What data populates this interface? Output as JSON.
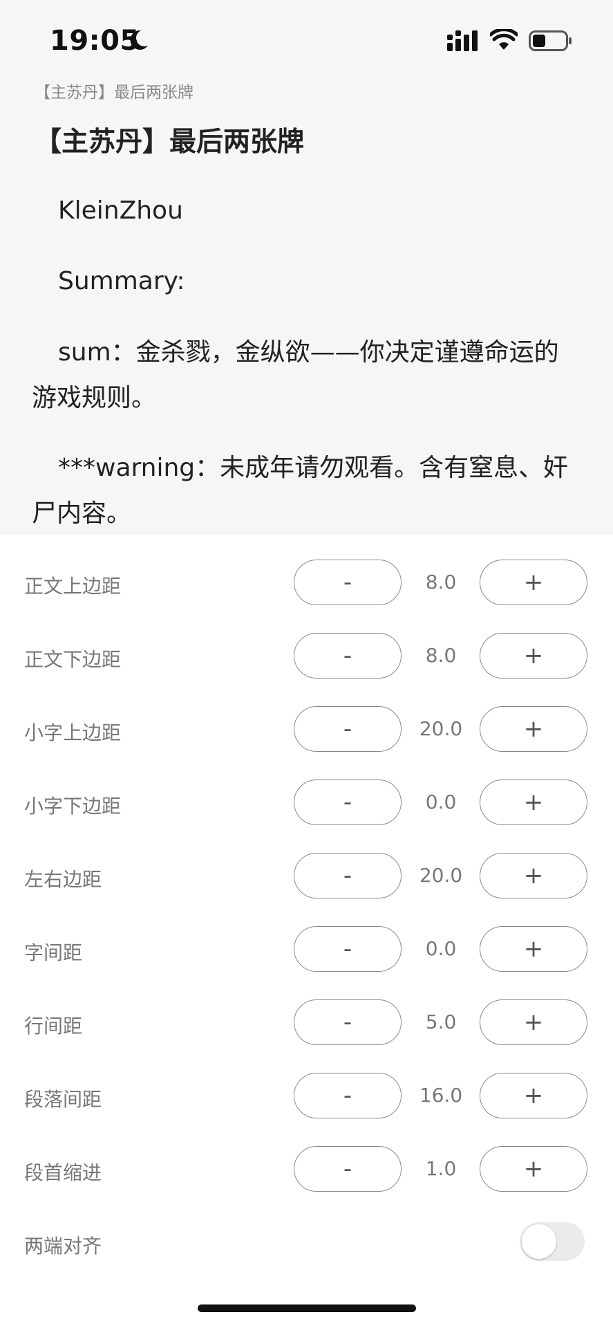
{
  "status_bar": {
    "time": "19:05",
    "icons": [
      "moon-icon",
      "cellular-signal-icon",
      "wifi-icon",
      "battery-icon"
    ]
  },
  "reader": {
    "chapter_header": "【主苏丹】最后两张牌",
    "title": "【主苏丹】最后两张牌",
    "paragraphs": [
      "KleinZhou",
      "Summary:",
      "sum：金杀戮，金纵欲——你决定谨遵命运的游戏规则。",
      "***warning：未成年请勿观看。含有窒息、奸尸内容。"
    ]
  },
  "settings": {
    "minus_label": "-",
    "plus_label": "+",
    "rows": [
      {
        "label": "正文上边距",
        "value": "8.0"
      },
      {
        "label": "正文下边距",
        "value": "8.0"
      },
      {
        "label": "小字上边距",
        "value": "20.0"
      },
      {
        "label": "小字下边距",
        "value": "0.0"
      },
      {
        "label": "左右边距",
        "value": "20.0"
      },
      {
        "label": "字间距",
        "value": "0.0"
      },
      {
        "label": "行间距",
        "value": "5.0"
      },
      {
        "label": "段落间距",
        "value": "16.0"
      },
      {
        "label": "段首缩进",
        "value": "1.0"
      }
    ],
    "justify": {
      "label": "两端对齐",
      "enabled": false
    }
  },
  "colors": {
    "reader_background": "#f6f6f6",
    "panel_background": "#ffffff",
    "label_text": "#777777",
    "button_border": "#8a8a8a"
  }
}
